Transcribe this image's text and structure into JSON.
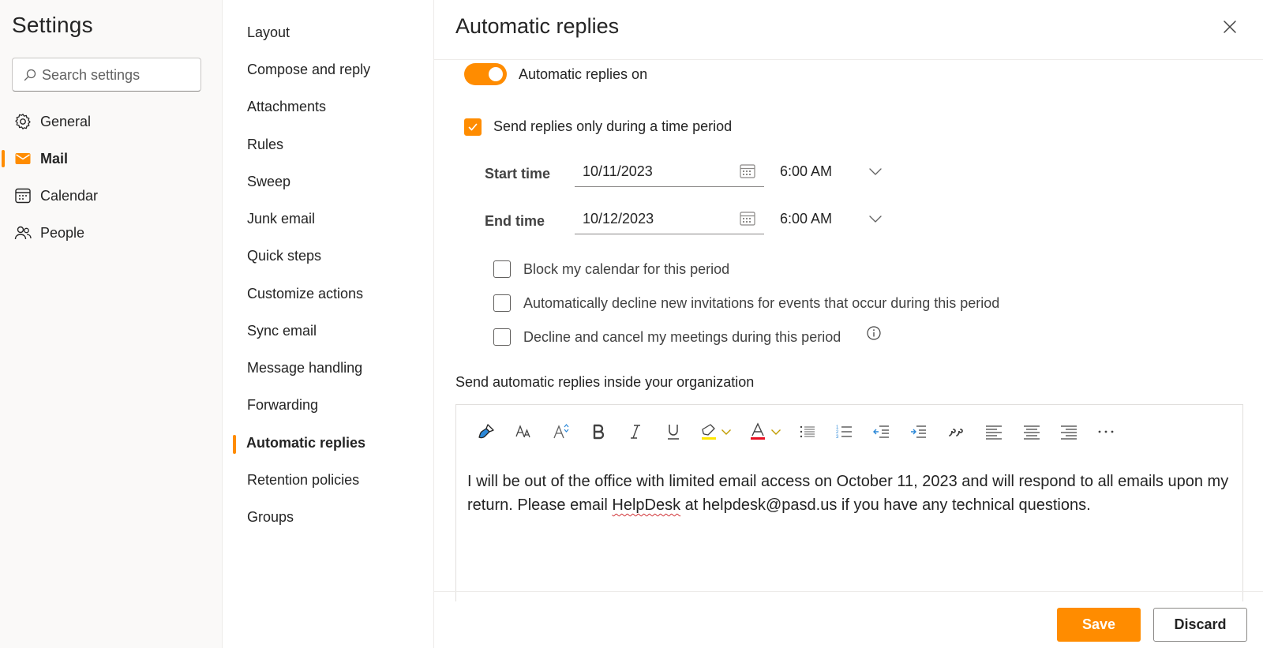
{
  "settings": {
    "title": "Settings",
    "search_placeholder": "Search settings"
  },
  "nav": {
    "items": [
      {
        "label": "General",
        "icon": "gear-icon"
      },
      {
        "label": "Mail",
        "icon": "mail-icon",
        "active": true
      },
      {
        "label": "Calendar",
        "icon": "calendar-icon"
      },
      {
        "label": "People",
        "icon": "people-icon"
      }
    ]
  },
  "subnav": {
    "items": [
      {
        "label": "Layout"
      },
      {
        "label": "Compose and reply"
      },
      {
        "label": "Attachments"
      },
      {
        "label": "Rules"
      },
      {
        "label": "Sweep"
      },
      {
        "label": "Junk email"
      },
      {
        "label": "Quick steps"
      },
      {
        "label": "Customize actions"
      },
      {
        "label": "Sync email"
      },
      {
        "label": "Message handling"
      },
      {
        "label": "Forwarding"
      },
      {
        "label": "Automatic replies",
        "active": true
      },
      {
        "label": "Retention policies"
      },
      {
        "label": "Groups"
      }
    ]
  },
  "panel": {
    "title": "Automatic replies",
    "toggle_label": "Automatic replies on",
    "toggle_on": true,
    "time_period_label": "Send replies only during a time period",
    "time_period_checked": true,
    "start": {
      "label": "Start time",
      "date": "10/11/2023",
      "time": "6:00 AM"
    },
    "end": {
      "label": "End time",
      "date": "10/12/2023",
      "time": "6:00 AM"
    },
    "options": [
      {
        "label": "Block my calendar for this period",
        "checked": false
      },
      {
        "label": "Automatically decline new invitations for events that occur during this period",
        "checked": false
      },
      {
        "label": "Decline and cancel my meetings during this period",
        "checked": false
      }
    ],
    "inside_org_label": "Send automatic replies inside your organization",
    "message": {
      "before": "I will be out of the office with limited email access on October 11, 2023 and will respond to all emails upon my return. Please email ",
      "misspelled": "HelpDesk",
      "after": " at helpdesk@pasd.us if you have any technical questions."
    },
    "save_label": "Save",
    "discard_label": "Discard"
  },
  "colors": {
    "accent": "#ff8c00",
    "text": "#242424",
    "sidebar_bg": "#faf9f8"
  }
}
